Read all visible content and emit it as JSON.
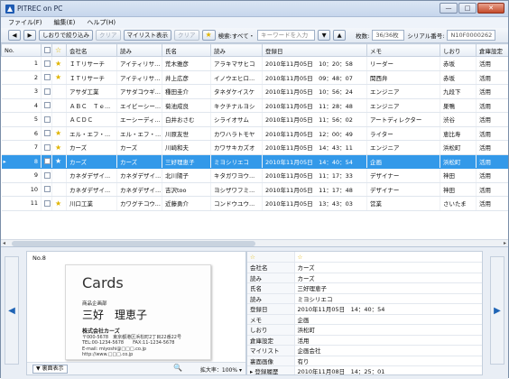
{
  "window": {
    "title": "PITREC on PC",
    "min": "—",
    "max": "□",
    "close": "✕"
  },
  "menu": [
    "ファイル(F)",
    "編集(E)",
    "ヘルプ(H)"
  ],
  "toolbar": {
    "prev": "◀",
    "next": "▶",
    "filter": "しおりで絞り込み",
    "clear1": "クリア",
    "mylist": "マイリスト表示",
    "clear2": "クリア",
    "search_label": "検索:すべて・",
    "search_placeholder": "キーワードを入力",
    "down": "▼",
    "up": "▲",
    "count_label": "枚数:",
    "count": "36/36枚",
    "serial_label": "シリアル番号:",
    "serial": "N10F0000262"
  },
  "columns": [
    "No.",
    "",
    "",
    "会社名",
    "読み",
    "氏名",
    "読み",
    "登録日",
    "メモ",
    "しおり",
    "倉庫設定"
  ],
  "rows": [
    {
      "no": "1",
      "star": true,
      "company": "ＩＴリサーチ",
      "yomi": "アイティリサ...",
      "name": "荒木雅彦",
      "name_yomi": "アラキマサヒコ",
      "date": "2010年11月05日　10：20：58",
      "memo": "リーダー",
      "shiori": "赤坂",
      "storage": "活用"
    },
    {
      "no": "2",
      "star": true,
      "company": "ＩＴリサーチ",
      "yomi": "アイティリサ...",
      "name": "井上広彦",
      "name_yomi": "イノウエヒロ...",
      "date": "2010年11月05日　09：48：07",
      "memo": "関西弁",
      "shiori": "赤坂",
      "storage": "活用"
    },
    {
      "no": "3",
      "star": false,
      "company": "アサダ工業",
      "yomi": "アサダコウギ...",
      "name": "種田圭介",
      "name_yomi": "タネダケイスケ",
      "date": "2010年11月05日　10：56：24",
      "memo": "エンジニア",
      "shiori": "九段下",
      "storage": "活用"
    },
    {
      "no": "4",
      "star": false,
      "company": "ＡＢＣ　Ｔｅ...",
      "yomi": "エイビーシー...",
      "name": "菊池成良",
      "name_yomi": "キクチナルヨシ",
      "date": "2010年11月05日　11：28：48",
      "memo": "エンジニア",
      "shiori": "巣鴨",
      "storage": "活用"
    },
    {
      "no": "5",
      "star": false,
      "company": "ＡＣＤＣ",
      "yomi": "エーシーディ...",
      "name": "白井おさむ",
      "name_yomi": "シライオサム",
      "date": "2010年11月05日　11：56：02",
      "memo": "アートディレクター",
      "shiori": "渋谷",
      "storage": "活用"
    },
    {
      "no": "6",
      "star": true,
      "company": "エル・エフ・...",
      "yomi": "エル・エフ・...",
      "name": "川原友世",
      "name_yomi": "カワハラトモヤ",
      "date": "2010年11月05日　12：00：49",
      "memo": "ライター",
      "shiori": "恵比寿",
      "storage": "活用"
    },
    {
      "no": "7",
      "star": true,
      "company": "カーズ",
      "yomi": "カーズ",
      "name": "川崎和夫",
      "name_yomi": "カワサキカズオ",
      "date": "2010年11月05日　14：43：11",
      "memo": "エンジニア",
      "shiori": "浜松町",
      "storage": "活用"
    },
    {
      "no": "8",
      "star": true,
      "company": "カーズ",
      "yomi": "カーズ",
      "name": "三好理恵子",
      "name_yomi": "ミヨシリエコ",
      "date": "2010年11月05日　14：40：54",
      "memo": "企画",
      "shiori": "浜松町",
      "storage": "活用",
      "selected": true
    },
    {
      "no": "9",
      "star": false,
      "company": "カネダデザイ...",
      "yomi": "カネダデザイ...",
      "name": "北川陽子",
      "name_yomi": "キタガワヨウ...",
      "date": "2010年11月05日　11：17：33",
      "memo": "デザイナー",
      "shiori": "神田",
      "storage": "活用"
    },
    {
      "no": "10",
      "star": false,
      "company": "カネダデザイ...",
      "yomi": "カネダデザイ...",
      "name": "吉沢too",
      "name_yomi": "ヨシザワフミ...",
      "date": "2010年11月05日　11：17：48",
      "memo": "デザイナー",
      "shiori": "神田",
      "storage": "活用"
    },
    {
      "no": "11",
      "star": true,
      "company": "川口工業",
      "yomi": "カワグチコウ...",
      "name": "近藤勇介",
      "name_yomi": "コンドウユウ...",
      "date": "2010年11月05日　13：43：03",
      "memo": "営業",
      "shiori": "さいたま",
      "storage": "活用"
    }
  ],
  "detail": {
    "no": "No.8",
    "card": {
      "brand": "Cards",
      "dept": "商品企画部",
      "name": "三好　理恵子",
      "company": "株式会社カーズ",
      "address": "〒000-5678　東京都港区浜松町2丁目22番22号\nTEL:00-1234-5678　　FAX:11-1234-5678\nE-mail: miyoshi@□□□.co.jp\nhttp://www.□□□.co.jp"
    },
    "back_label": "▼ 裏面表示",
    "zoom_label": "拡大率：",
    "zoom_value": "100%",
    "props": [
      {
        "k": "☆",
        "v": "☆"
      },
      {
        "k": "会社名",
        "v": "カーズ"
      },
      {
        "k": "読み",
        "v": "カーズ"
      },
      {
        "k": "氏名",
        "v": "三好理恵子"
      },
      {
        "k": "読み",
        "v": "ミヨシリエコ"
      },
      {
        "k": "登録日",
        "v": "2010年11月05日　14：40：54"
      },
      {
        "k": "メモ",
        "v": "企画"
      },
      {
        "k": "しおり",
        "v": "浜松町"
      },
      {
        "k": "倉庫設定",
        "v": "活用"
      },
      {
        "k": "マイリスト",
        "v": "企画会社"
      },
      {
        "k": "裏面画像",
        "v": "有り"
      },
      {
        "k": "▸ 登録履歴",
        "v": "2010年11月08日　14：25：01"
      }
    ]
  },
  "colors": {
    "selected": "#3399e9",
    "star": "#e0b400",
    "nav_arrow": "#1f64b5"
  }
}
